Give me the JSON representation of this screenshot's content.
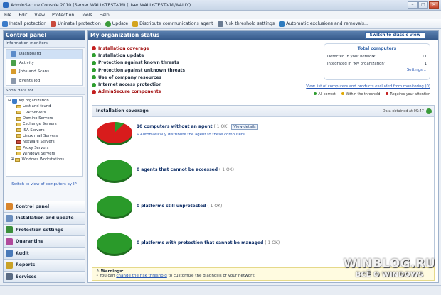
{
  "window": {
    "title": "AdminSecure Console 2010  (Server WALLY-TEST-VM) (User WALLY-TEST-VM\\WALLY)"
  },
  "menu": [
    "File",
    "Edit",
    "View",
    "Protection",
    "Tools",
    "Help"
  ],
  "toolbar": [
    {
      "label": "Install protection",
      "icon": "install-icon",
      "color": "#3c7cc9"
    },
    {
      "label": "Uninstall protection",
      "icon": "uninstall-icon",
      "color": "#c94a3c"
    },
    {
      "label": "Update",
      "icon": "update-icon",
      "color": "#3b9b3b"
    },
    {
      "label": "Distribute communications agent",
      "icon": "agent-icon",
      "color": "#d4a41f"
    },
    {
      "label": "Risk threshold settings",
      "icon": "risk-icon",
      "color": "#6a7b92"
    },
    {
      "label": "Automatic exclusions and removals...",
      "icon": "exclusions-icon",
      "color": "#2e7bbf"
    }
  ],
  "sidebar": {
    "title": "Control panel",
    "info_label": "Information monitors",
    "monitors": [
      "Dashboard",
      "Activity",
      "Jobs and Scans",
      "Events log"
    ],
    "show_data_label": "Show data for...",
    "tree": [
      "My organization",
      "Lost and found",
      "CVP Servers",
      "Domino Servers",
      "Exchange Servers",
      "ISA Servers",
      "Linux mail Servers",
      "NetWare Servers",
      "Proxy Servers",
      "Windows Servers",
      "Windows Workstations"
    ],
    "switch_ip": "Switch to view of computers by IP",
    "nav": [
      "Control panel",
      "Installation and update",
      "Protection settings",
      "Quarantine",
      "Audit",
      "Reports",
      "Services"
    ]
  },
  "main": {
    "title": "My organization status",
    "classic_button": "Switch to classic view",
    "statuses": [
      {
        "label": "Installation coverage",
        "state": "red"
      },
      {
        "label": "Installation update",
        "state": "green"
      },
      {
        "label": "Protection against known threats",
        "state": "green"
      },
      {
        "label": "Protection against unknown threats",
        "state": "green"
      },
      {
        "label": "Use of company resources",
        "state": "green"
      },
      {
        "label": "Internet access protection",
        "state": "green"
      },
      {
        "label": "AdminSecure components",
        "state": "red"
      }
    ],
    "totals": {
      "title": "Total computers",
      "detected_label": "Detected in your network",
      "detected": "11",
      "integrated_label": "Integrated in 'My organization'",
      "integrated": "1",
      "settings": "Settings..."
    },
    "excluded_link": "View list of computers and products excluded from monitoring (0)",
    "legend": [
      {
        "label": "All correct",
        "color": "#2e9d2e"
      },
      {
        "label": "Within the threshold",
        "color": "#e0a800"
      },
      {
        "label": "Requires your attention",
        "color": "#c41f1f"
      }
    ],
    "coverage": {
      "title": "Installation coverage",
      "date": "Data obtained at 09:47",
      "items": [
        {
          "text": "10 computers without an agent",
          "status": "( 1 OK)",
          "fraction_ok": 0.09,
          "button": "View details",
          "link": "Automatically distribute the agent to these computers"
        },
        {
          "text": "0 agents that cannot be accessed",
          "status": "( 1 OK)",
          "fraction_ok": 1
        },
        {
          "text": "0 platforms still unprotected",
          "status": "( 1 OK)",
          "fraction_ok": 1
        },
        {
          "text": "0 platforms with protection that cannot be managed",
          "status": "( 1 OK)",
          "fraction_ok": 1
        }
      ]
    },
    "warnings": {
      "title": "Warnings:",
      "prefix": "You can",
      "link": "change the risk threshold",
      "suffix": "to customize the diagnosis of your network."
    }
  },
  "watermark": {
    "line1": "WINBLOG.RU",
    "line2": "ВСЁ О WINDOWS"
  }
}
